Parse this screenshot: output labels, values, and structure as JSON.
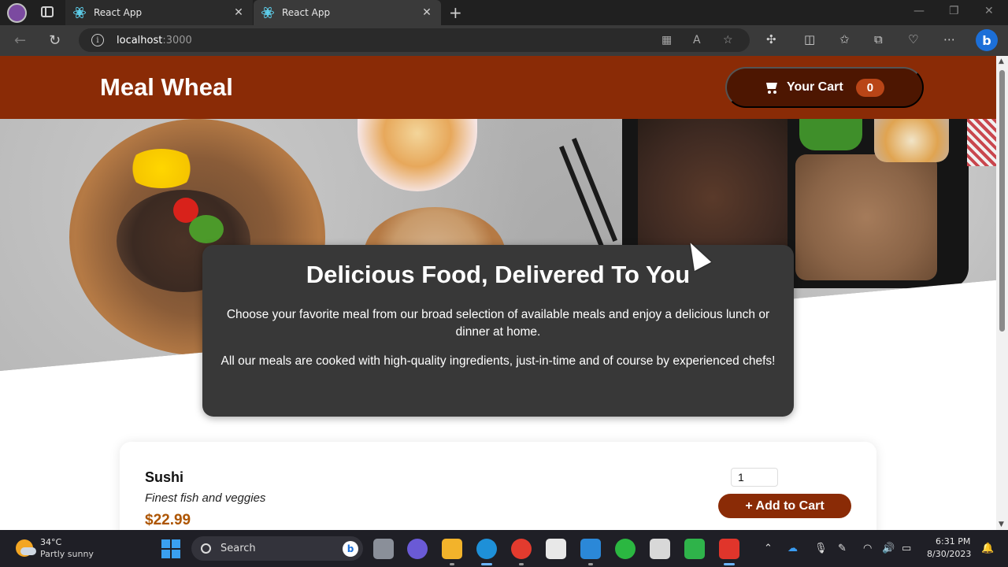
{
  "browser": {
    "tabs": [
      {
        "title": "React App",
        "close": "✕"
      },
      {
        "title": "React App",
        "close": "✕"
      }
    ],
    "new_tab": "+",
    "url": {
      "host": "localhost",
      "port": ":3000"
    }
  },
  "header": {
    "brand": "Meal Wheal",
    "cart_label": "Your Cart",
    "cart_count": "0"
  },
  "summary": {
    "title": "Delicious Food, Delivered To You",
    "paragraph1": "Choose your favorite meal from our broad selection of available meals and enjoy a delicious lunch or dinner at home.",
    "paragraph2": "All our meals are cooked with high-quality ingredients, just-in-time and of course by experienced chefs!"
  },
  "meals": [
    {
      "name": "Sushi",
      "description": "Finest fish and veggies",
      "price": "$22.99",
      "quantity": "1",
      "add_label": "+ Add to Cart"
    }
  ],
  "taskbar": {
    "weather_temp": "34°C",
    "weather_desc": "Partly sunny",
    "search_label": "Search",
    "time": "6:31 PM",
    "date": "8/30/2023"
  },
  "colors": {
    "header_bg": "#8a2b06",
    "cart_button_bg": "#4d1601",
    "cart_badge_bg": "#b94517",
    "summary_bg": "#383838",
    "price": "#ad5502"
  }
}
